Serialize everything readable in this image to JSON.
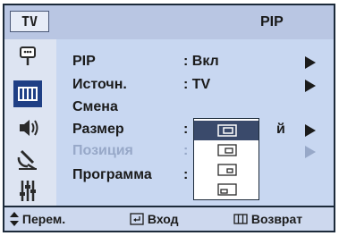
{
  "header": {
    "tv_tag": "TV",
    "title": "PIP"
  },
  "sidebar": {
    "items": [
      {
        "icon": "setup-icon",
        "active": false
      },
      {
        "icon": "menu-icon",
        "active": true
      },
      {
        "icon": "speaker-icon",
        "active": false
      },
      {
        "icon": "antenna-icon",
        "active": false
      },
      {
        "icon": "equalizer-icon",
        "active": false
      }
    ]
  },
  "menu": {
    "rows": [
      {
        "label": "PIP",
        "value": ": Вкл",
        "arrow": true,
        "enabled": true
      },
      {
        "label": "Источн.",
        "value": ": TV",
        "arrow": true,
        "enabled": true
      },
      {
        "label": "Смена",
        "value": "",
        "arrow": false,
        "enabled": true
      },
      {
        "label": "Размер",
        "value": ":",
        "value_tail": "й",
        "arrow": true,
        "enabled": true
      },
      {
        "label": "Позиция",
        "value": ":",
        "arrow": true,
        "enabled": false
      },
      {
        "label": "Программа",
        "value": ":",
        "arrow": false,
        "enabled": true
      }
    ]
  },
  "size_popup": {
    "options": [
      "size-large-icon",
      "size-medium-icon",
      "size-small-icon",
      "size-double-icon"
    ],
    "selected_index": 0
  },
  "footer": {
    "move": "Перем.",
    "enter": "Вход",
    "return": "Возврат"
  },
  "colors": {
    "panel": "#c8d7f1",
    "active_icon_bg": "#1f3f85",
    "disabled_text": "#97a8c8"
  }
}
